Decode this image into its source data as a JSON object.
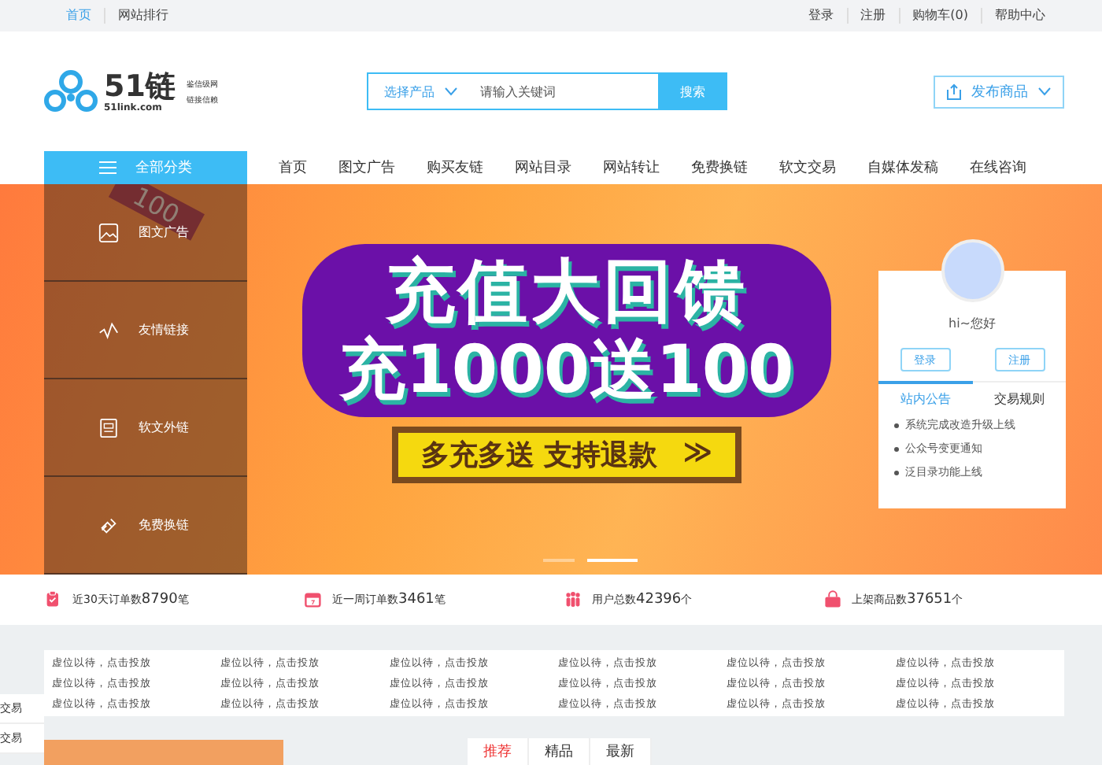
{
  "top_bar": {
    "left": [
      {
        "label": "首页",
        "selected": true
      },
      {
        "label": "网站排行",
        "selected": false
      }
    ],
    "right": [
      "登录",
      "注册",
      "购物车(0)",
      "帮助中心"
    ]
  },
  "header": {
    "logo": {
      "name": "51链",
      "domain": "51link.com",
      "slogan_1": "鉴信级网",
      "slogan_2": "链接信赖"
    },
    "search": {
      "category": "选择产品",
      "placeholder": "请输入关键词",
      "button": "搜索"
    },
    "publish": "发布商品"
  },
  "nav": {
    "all_categories": "全部分类",
    "items": [
      {
        "label": "首页",
        "selected": false
      },
      {
        "label": "图文广告",
        "selected": false
      },
      {
        "label": "购买友链",
        "selected": false
      },
      {
        "label": "网站目录",
        "selected": false
      },
      {
        "label": "网站转让",
        "selected": false
      },
      {
        "label": "免费换链",
        "selected": false
      },
      {
        "label": "软文交易",
        "selected": false
      },
      {
        "label": "自媒体发稿",
        "selected": false
      },
      {
        "label": "在线咨询",
        "selected": false
      }
    ]
  },
  "categories": [
    {
      "kind": "image",
      "label": "图文广告"
    },
    {
      "kind": "chart",
      "label": "友情链接"
    },
    {
      "kind": "doc",
      "label": "软文外链"
    },
    {
      "kind": "link",
      "label": "免费换链"
    }
  ],
  "banner": {
    "badge": "100",
    "line_1": "充值大回馈",
    "line_2": "充1000送100",
    "tagline": "多充多送 支持退款",
    "arrows": "≫",
    "slides": [
      {
        "selected": false
      },
      {
        "selected": true
      }
    ]
  },
  "user_card": {
    "greeting": "hi~您好",
    "login": "登录",
    "register": "注册",
    "tabs": [
      {
        "label": "站内公告",
        "selected": true
      },
      {
        "label": "交易规则",
        "selected": false
      }
    ],
    "notices": [
      "系统完成改造升级上线",
      "公众号变更通知",
      "泛目录功能上线"
    ]
  },
  "stats": [
    {
      "kind": "clipboard",
      "label": "近30天订单数",
      "value": "8790",
      "unit": "笔"
    },
    {
      "kind": "calendar",
      "label": "近一周订单数",
      "value": "3461",
      "unit": "笔"
    },
    {
      "kind": "users",
      "label": "用户总数",
      "value": "42396",
      "unit": "个"
    },
    {
      "kind": "bag",
      "label": "上架商品数",
      "value": "37651",
      "unit": "个"
    }
  ],
  "ads": [
    "虚位以待，点击投放",
    "虚位以待，点击投放",
    "虚位以待，点击投放",
    "虚位以待，点击投放",
    "虚位以待，点击投放",
    "虚位以待，点击投放",
    "虚位以待，点击投放",
    "虚位以待，点击投放",
    "虚位以待，点击投放",
    "虚位以待，点击投放",
    "虚位以待，点击投放",
    "虚位以待，点击投放",
    "虚位以待，点击投放",
    "虚位以待，点击投放",
    "虚位以待，点击投放",
    "虚位以待，点击投放",
    "虚位以待，点击投放",
    "虚位以待，点击投放"
  ],
  "side_links": [
    "交易",
    "交易"
  ],
  "bottom_tabs": [
    {
      "label": "推荐",
      "selected": true
    },
    {
      "label": "精品",
      "selected": false
    },
    {
      "label": "最新",
      "selected": false
    }
  ]
}
